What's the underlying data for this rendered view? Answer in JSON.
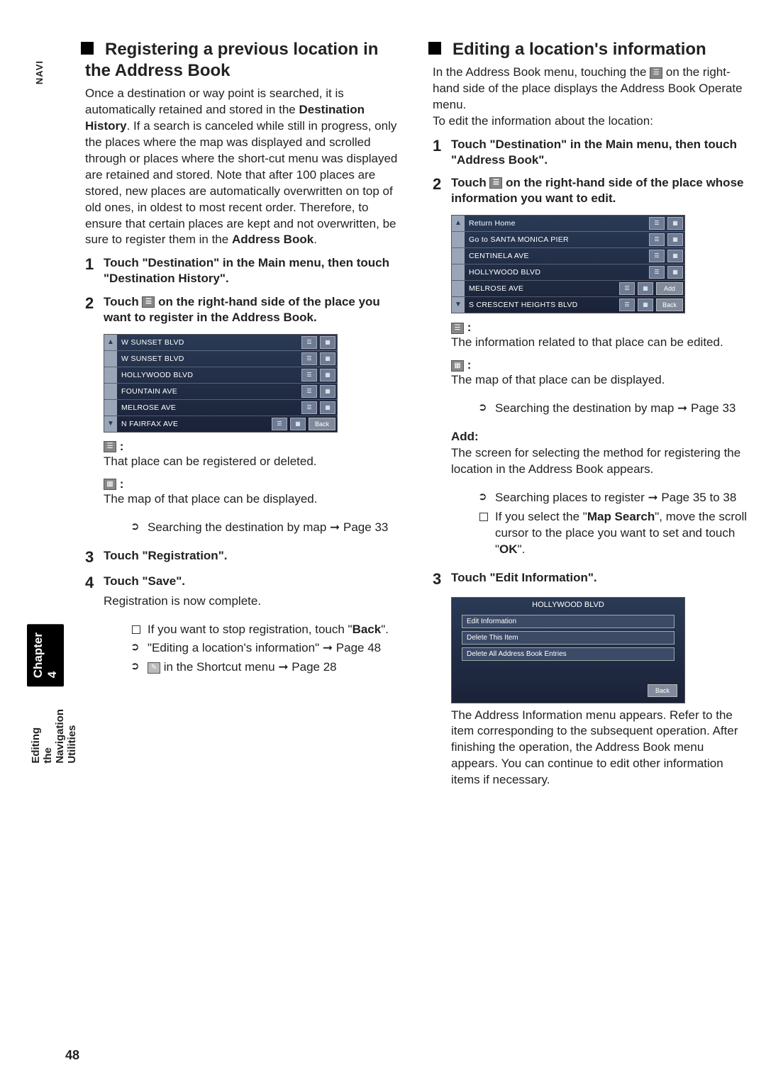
{
  "page_number": "48",
  "side": {
    "navi": "NAVI",
    "chapter": "Chapter 4",
    "utilities": "Editing the Navigation Utilities"
  },
  "left": {
    "heading": "Registering a previous location in the Address Book",
    "intro_a": "Once a destination or way point is searched, it is automatically retained and stored in the ",
    "intro_b": "Destination History",
    "intro_c": ". If a search is canceled while still in progress, only the places where the map was displayed and scrolled through or places where the short-cut menu was displayed are retained and stored. Note that after 100 places are stored, new places are automatically overwritten on top of old ones, in oldest to most recent order. Therefore, to ensure that certain places are kept and not overwritten, be sure to register them in the ",
    "intro_d": "Address Book",
    "intro_e": ".",
    "step1": "Touch \"Destination\" in the Main menu, then touch \"Destination History\".",
    "step2_a": "Touch ",
    "step2_b": " on the right-hand side of the place you want to register in the Address Book.",
    "shot_rows": [
      "W SUNSET BLVD",
      "W SUNSET BLVD",
      "HOLLYWOOD BLVD",
      "FOUNTAIN AVE",
      "MELROSE AVE",
      "N FAIRFAX AVE"
    ],
    "shot_back": "Back",
    "icon1_text": "That place can be registered or deleted.",
    "icon2_text": "The map of that place can be displayed.",
    "icon2_ref": "Searching the destination by map ➞ Page 33",
    "step3": "Touch \"Registration\".",
    "step4": "Touch \"Save\".",
    "step4_sub": "Registration is now complete.",
    "step4_b1_a": "If you want to stop registration, touch \"",
    "step4_b1_b": "Back",
    "step4_b1_c": "\".",
    "step4_b2": "\"Editing a location's information\" ➞ Page 48",
    "step4_b3": " in the Shortcut menu ➞ Page 28"
  },
  "right": {
    "heading": "Editing a location's information",
    "intro_a": "In the Address Book menu, touching the ",
    "intro_b": " on the right-hand side of the place displays the Address Book Operate menu.",
    "intro_c": "To edit the information about the location:",
    "step1": "Touch \"Destination\" in the Main menu, then touch \"Address Book\".",
    "step2_a": "Touch ",
    "step2_b": " on the right-hand side of the place whose information you want to edit.",
    "shot_rows": [
      "Return Home",
      "Go to SANTA MONICA PIER",
      "CENTINELA AVE",
      "HOLLYWOOD BLVD",
      "MELROSE AVE",
      "S CRESCENT HEIGHTS BLVD"
    ],
    "shot_add": "Add",
    "shot_back": "Back",
    "icon1_text": "The information related to that place can be edited.",
    "icon2_text": "The map of that place can be displayed.",
    "icon2_ref": "Searching the destination by map ➞ Page 33",
    "add_label": "Add:",
    "add_text": "The screen for selecting the method for registering the location in the Address Book appears.",
    "add_b1": "Searching places to register ➞ Page 35 to 38",
    "add_b2_a": "If you select the \"",
    "add_b2_b": "Map Search",
    "add_b2_c": "\", move the scroll cursor to the place you want to set and touch \"",
    "add_b2_d": "OK",
    "add_b2_e": "\".",
    "step3": "Touch \"Edit Information\".",
    "shot2_title": "HOLLYWOOD BLVD",
    "shot2_opts": [
      "Edit Information",
      "Delete This Item",
      "Delete All Address Book Entries"
    ],
    "shot2_back": "Back",
    "after": "The Address Information menu appears. Refer to the item corresponding to the subsequent operation. After finishing the operation, the Address Book menu appears. You can continue to edit other information items if necessary."
  }
}
